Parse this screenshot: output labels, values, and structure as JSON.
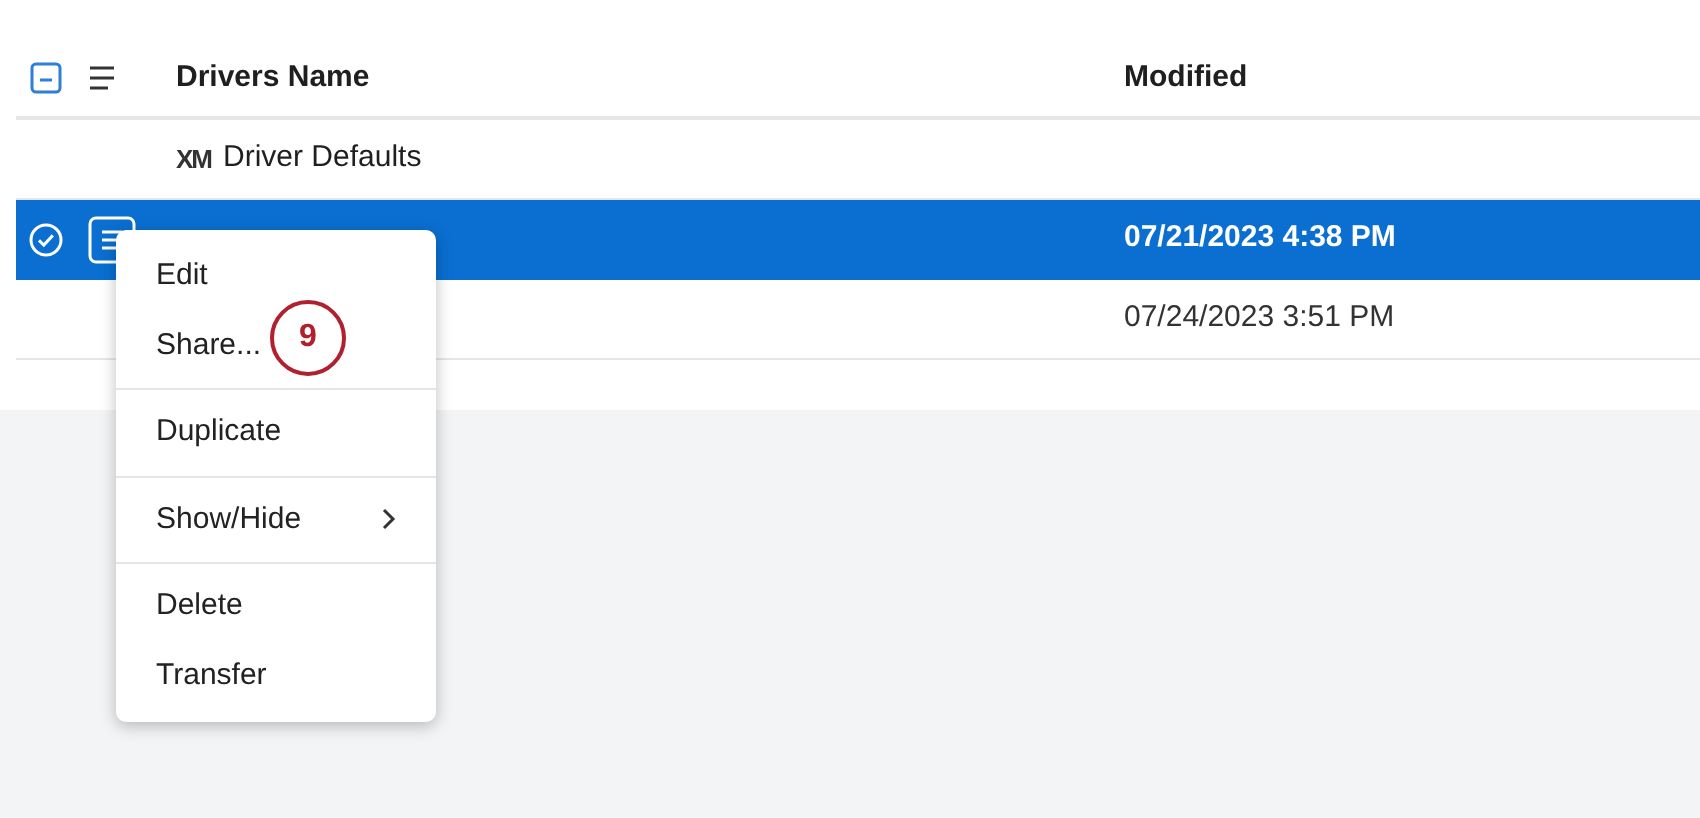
{
  "table": {
    "select_all": {
      "indeterminate": true
    },
    "columns": [
      {
        "label": "Drivers Name"
      },
      {
        "label": "Modified"
      }
    ],
    "rows": [
      {
        "logo": "XM",
        "name": "Driver Defaults",
        "modified": "",
        "selected": false
      },
      {
        "name": "",
        "modified": "07/21/2023 4:38 PM",
        "selected": true
      },
      {
        "name": "",
        "modified": "07/24/2023 3:51 PM",
        "selected": false
      }
    ]
  },
  "context_menu": {
    "groups": [
      [
        {
          "label": "Edit",
          "submenu": false
        },
        {
          "label": "Share...",
          "submenu": false
        }
      ],
      [
        {
          "label": "Duplicate",
          "submenu": false
        }
      ],
      [
        {
          "label": "Show/Hide",
          "submenu": true
        }
      ],
      [
        {
          "label": "Delete",
          "submenu": false
        },
        {
          "label": "Transfer",
          "submenu": false
        }
      ]
    ]
  },
  "step_callout": {
    "label": "9"
  }
}
